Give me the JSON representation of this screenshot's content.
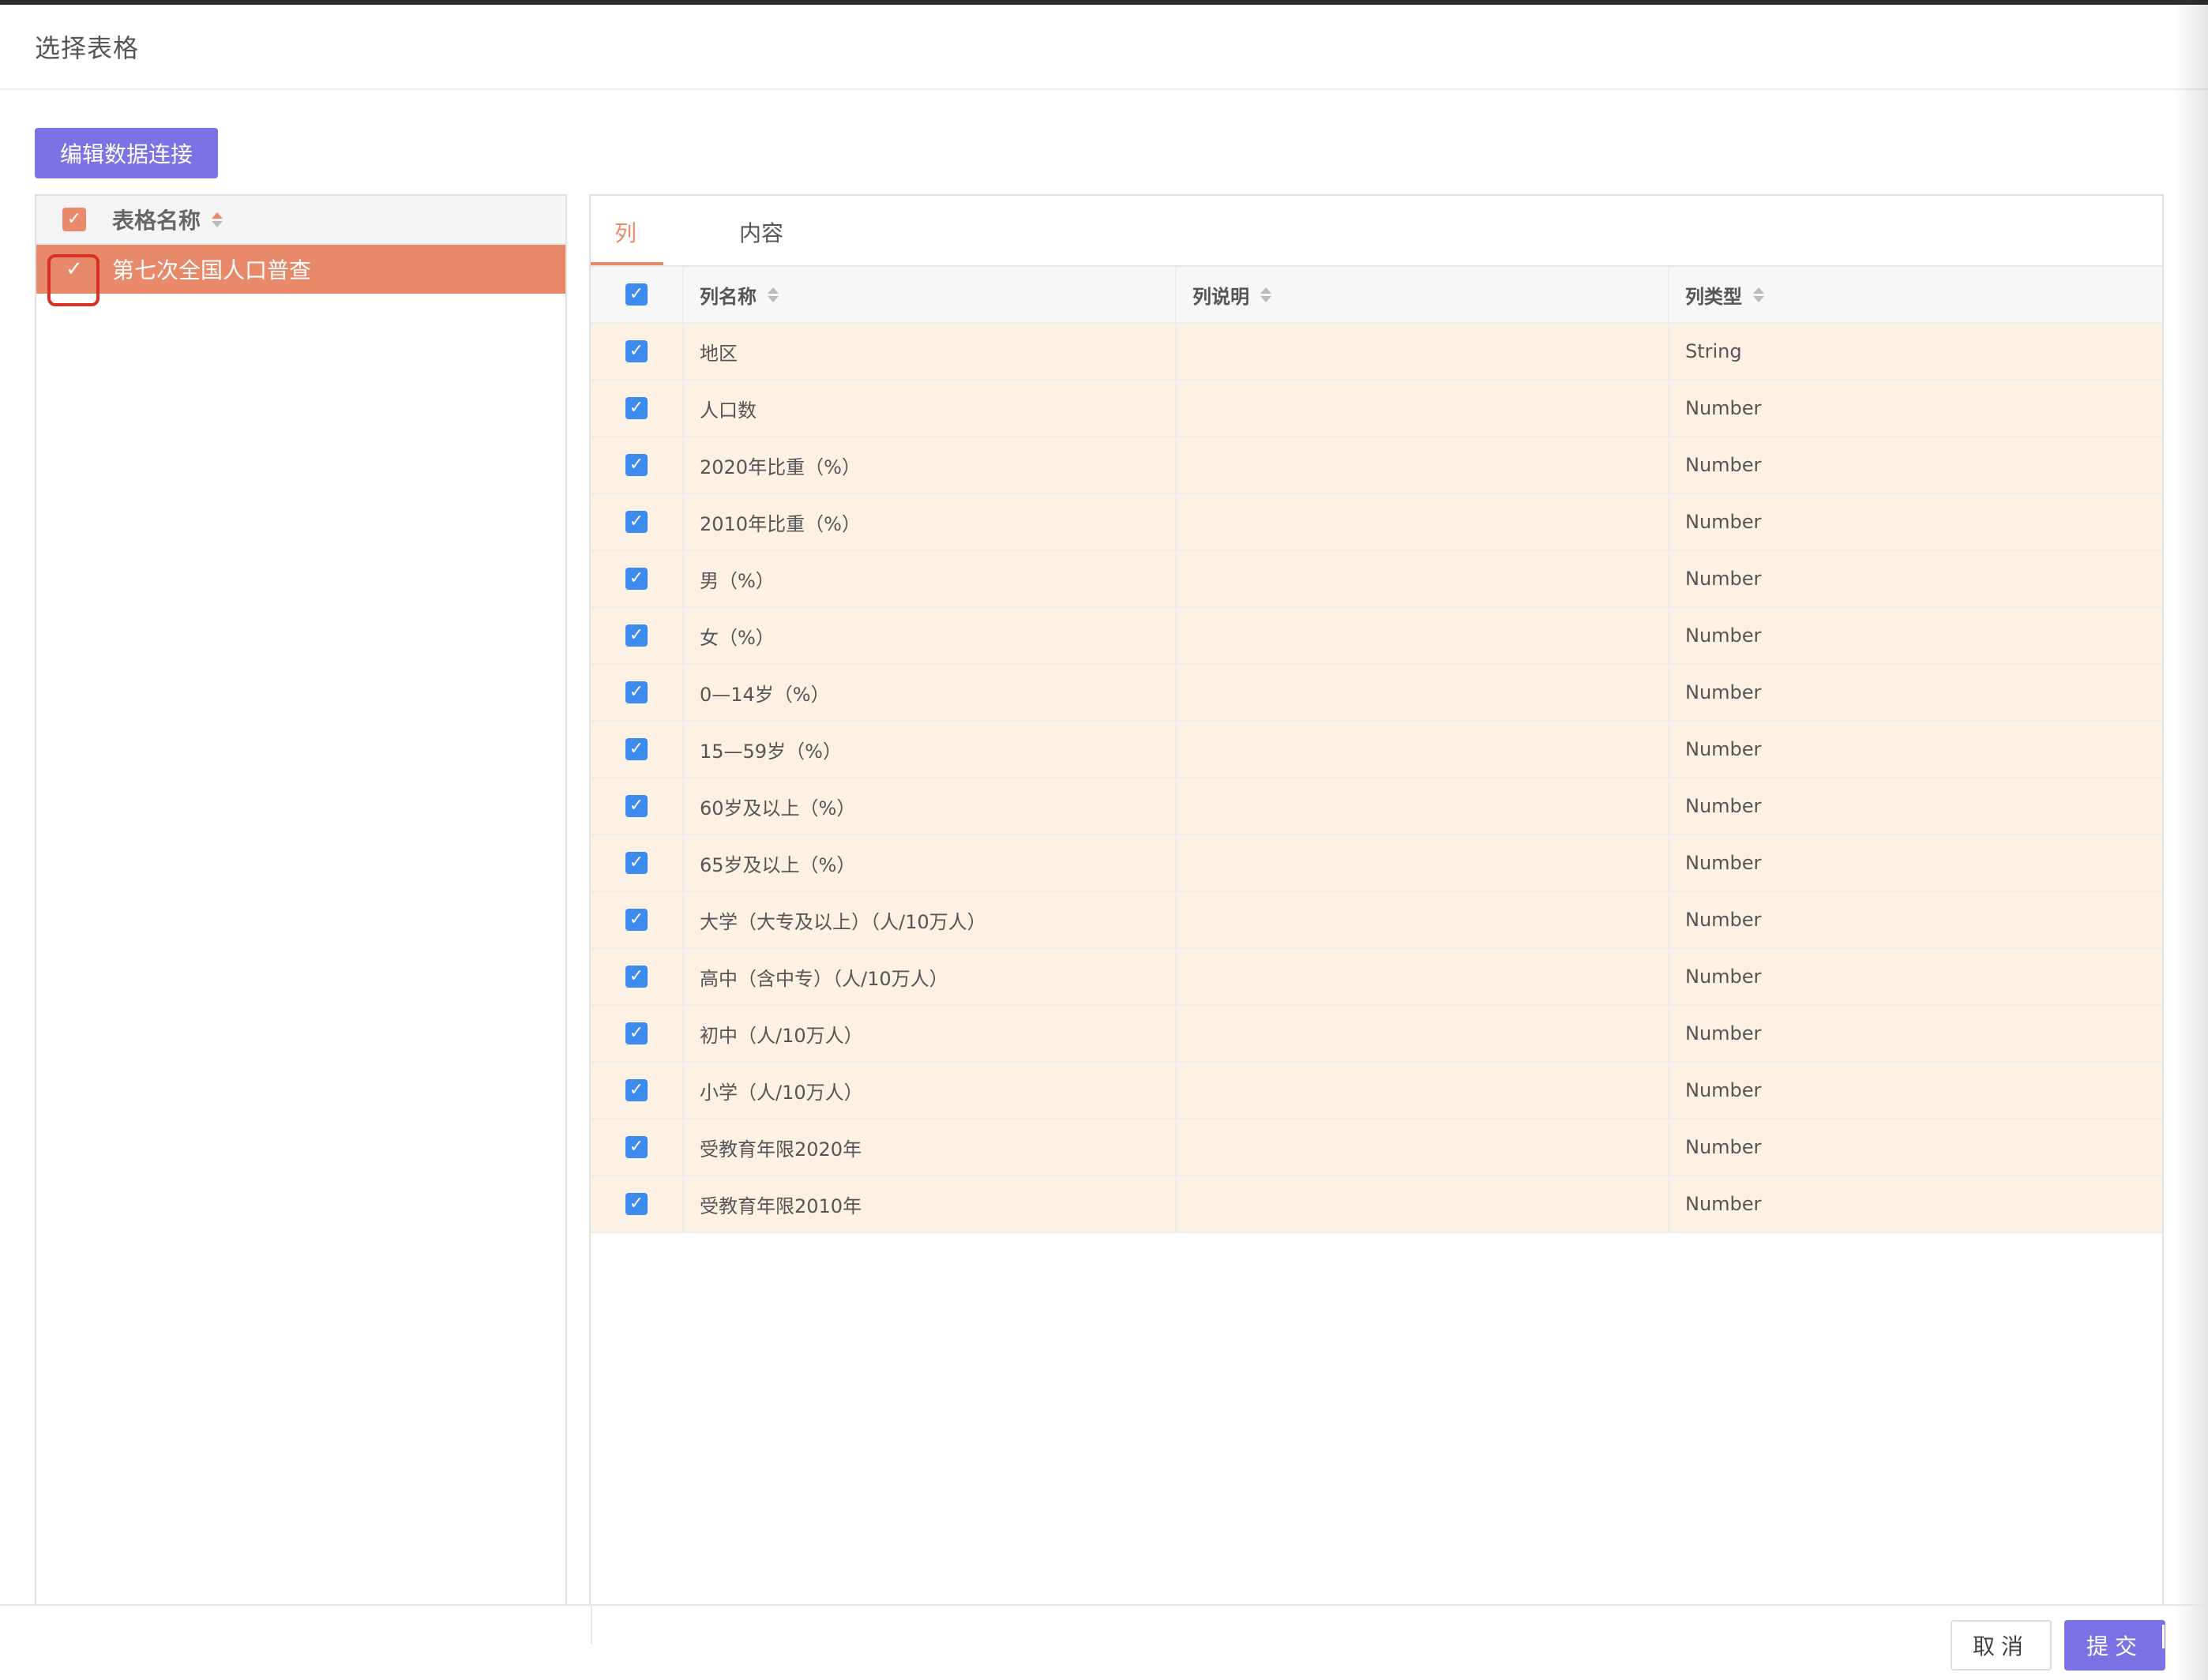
{
  "dialog": {
    "title": "选择表格"
  },
  "toolbar": {
    "edit_connection_label": "编辑数据连接"
  },
  "table_list": {
    "header_label": "表格名称",
    "all_checked": true,
    "rows": [
      {
        "name": "第七次全国人口普查",
        "checked": true,
        "selected": true
      }
    ]
  },
  "tabs": [
    {
      "label": "列",
      "active": true
    },
    {
      "label": "内容",
      "active": false
    }
  ],
  "columns_grid": {
    "headers": {
      "name": "列名称",
      "description": "列说明",
      "type": "列类型"
    },
    "all_checked": true,
    "rows": [
      {
        "name": "地区",
        "description": "",
        "type": "String",
        "checked": true
      },
      {
        "name": "人口数",
        "description": "",
        "type": "Number",
        "checked": true
      },
      {
        "name": "2020年比重（%）",
        "description": "",
        "type": "Number",
        "checked": true
      },
      {
        "name": "2010年比重（%）",
        "description": "",
        "type": "Number",
        "checked": true
      },
      {
        "name": "男（%）",
        "description": "",
        "type": "Number",
        "checked": true
      },
      {
        "name": "女（%）",
        "description": "",
        "type": "Number",
        "checked": true
      },
      {
        "name": "0—14岁（%）",
        "description": "",
        "type": "Number",
        "checked": true
      },
      {
        "name": "15—59岁（%）",
        "description": "",
        "type": "Number",
        "checked": true
      },
      {
        "name": "60岁及以上（%）",
        "description": "",
        "type": "Number",
        "checked": true
      },
      {
        "name": "65岁及以上（%）",
        "description": "",
        "type": "Number",
        "checked": true
      },
      {
        "name": "大学（大专及以上）（人/10万人）",
        "description": "",
        "type": "Number",
        "checked": true
      },
      {
        "name": "高中（含中专）（人/10万人）",
        "description": "",
        "type": "Number",
        "checked": true
      },
      {
        "name": "初中（人/10万人）",
        "description": "",
        "type": "Number",
        "checked": true
      },
      {
        "name": "小学（人/10万人）",
        "description": "",
        "type": "Number",
        "checked": true
      },
      {
        "name": "受教育年限2020年",
        "description": "",
        "type": "Number",
        "checked": true
      },
      {
        "name": "受教育年限2010年",
        "description": "",
        "type": "Number",
        "checked": true
      }
    ]
  },
  "footer": {
    "cancel_label": "取消",
    "submit_label": "提交"
  },
  "colors": {
    "accent_purple": "#7b72e6",
    "accent_orange": "#e8896a",
    "checkbox_blue": "#3e8bf0",
    "row_bg": "#fcf1e2"
  },
  "icons": {
    "checkbox": "check-icon",
    "sort": "sort-icon"
  }
}
